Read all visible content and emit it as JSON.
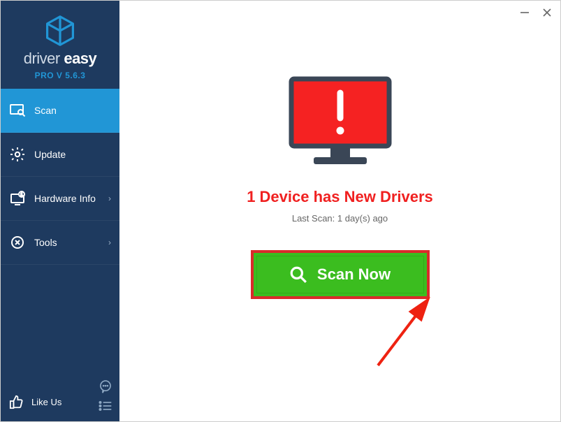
{
  "branding": {
    "logo_text_prefix": "driver ",
    "logo_text_bold": "easy",
    "version": "PRO V 5.6.3"
  },
  "sidebar": {
    "items": [
      {
        "label": "Scan",
        "has_sub": false
      },
      {
        "label": "Update",
        "has_sub": false
      },
      {
        "label": "Hardware Info",
        "has_sub": true
      },
      {
        "label": "Tools",
        "has_sub": true
      }
    ]
  },
  "footer": {
    "like_label": "Like Us"
  },
  "main": {
    "headline": "1 Device has New Drivers",
    "subline": "Last Scan: 1 day(s) ago",
    "scan_button_label": "Scan Now"
  },
  "icons": {
    "scan": "scan-icon",
    "update": "gear-icon",
    "hardware": "monitor-badge-icon",
    "tools": "toolbox-icon",
    "like": "thumbs-up-icon",
    "feedback": "chat-bubble-icon",
    "menu": "menu-lines-icon",
    "search": "search-icon",
    "alert": "exclamation-icon"
  },
  "colors": {
    "sidebar_bg": "#1e3a5f",
    "accent": "#2196d6",
    "danger": "#f02020",
    "scan_green": "#3bbd1f",
    "scan_border": "#d92b2b"
  }
}
